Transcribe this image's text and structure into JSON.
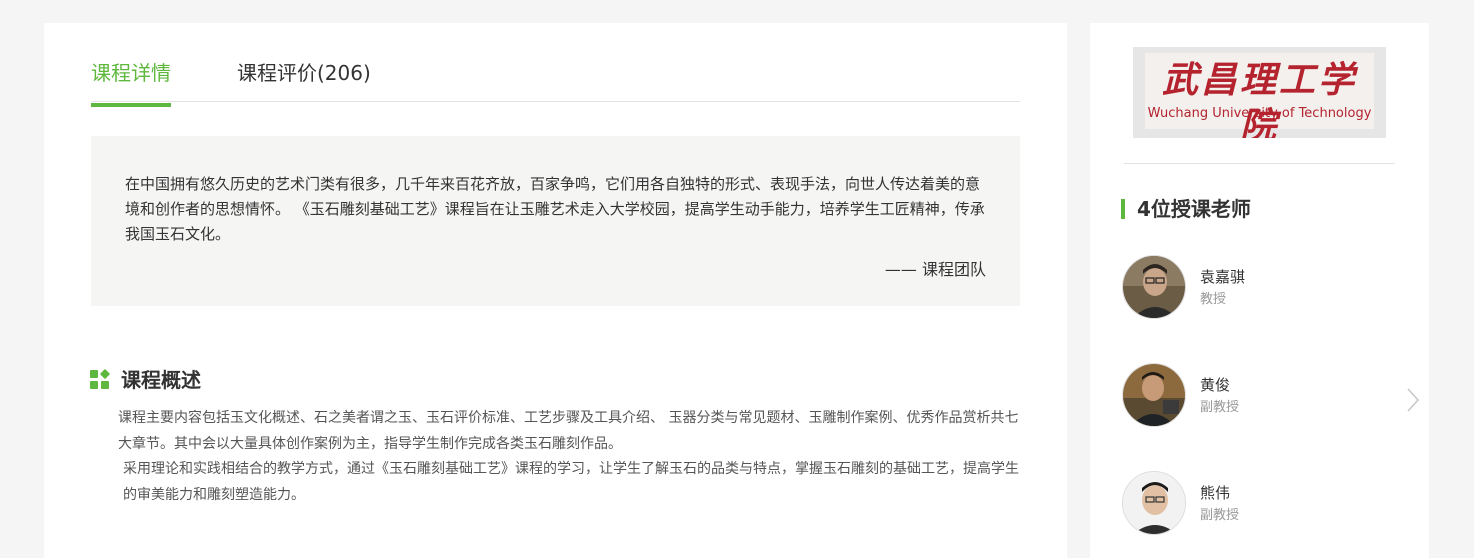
{
  "tabs": [
    {
      "label": "课程详情",
      "active": true
    },
    {
      "label": "课程评价(206)",
      "active": false
    }
  ],
  "quote": {
    "text": "在中国拥有悠久历史的艺术门类有很多，几千年来百花齐放，百家争鸣，它们用各自独特的形式、表现手法，向世人传达着美的意境和创作者的思想情怀。 《玉石雕刻基础工艺》课程旨在让玉雕艺术走入大学校园，提高学生动手能力，培养学生工匠精神，传承我国玉石文化。",
    "signature": "—— 课程团队"
  },
  "overview": {
    "title": "课程概述",
    "icon": "grid-icon",
    "paragraphs": [
      "课程主要内容包括玉文化概述、石之美者谓之玉、玉石评价标准、工艺步骤及工具介绍、 玉器分类与常见题材、玉雕制作案例、优秀作品赏析共七大章节。其中会以大量具体创作案例为主，指导学生制作完成各类玉石雕刻作品。",
      "采用理论和实践相结合的教学方式，通过《玉石雕刻基础工艺》课程的学习，让学生了解玉石的品类与特点，掌握玉石雕刻的基础工艺，提高学生的审美能力和雕刻塑造能力。"
    ]
  },
  "school": {
    "logo_cn": "武昌理工学院",
    "logo_en": "Wuchang University of Technology"
  },
  "teachers": {
    "heading": "4位授课老师",
    "list": [
      {
        "name": "袁嘉骐",
        "title": "教授"
      },
      {
        "name": "黄俊",
        "title": "副教授"
      },
      {
        "name": "熊伟",
        "title": "副教授"
      }
    ]
  },
  "colors": {
    "accent": "#5fb83e",
    "logo_red": "#b4232e",
    "page_bg": "#f5f5f5",
    "quote_bg": "#f5f6f4"
  },
  "icons": {
    "next": "chevron-right-icon"
  }
}
